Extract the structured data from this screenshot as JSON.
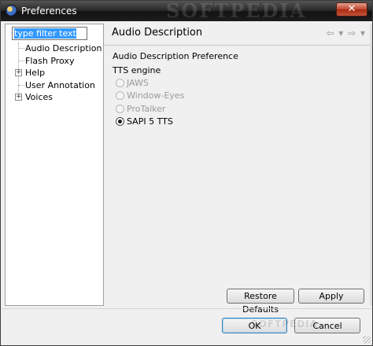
{
  "window": {
    "title": "Preferences",
    "watermark": "SOFTPEDIA",
    "close_glyph": "✕"
  },
  "filter": {
    "value": "type filter text"
  },
  "tree": {
    "items": [
      {
        "label": "Audio Description",
        "expandable": false
      },
      {
        "label": "Flash Proxy",
        "expandable": false
      },
      {
        "label": "Help",
        "expandable": true
      },
      {
        "label": "User Annotation",
        "expandable": false
      },
      {
        "label": "Voices",
        "expandable": true
      }
    ],
    "expander_glyph": "+"
  },
  "page": {
    "title": "Audio Description",
    "nav_back_glyph": "⇦",
    "nav_menu_glyph": "▾",
    "nav_forward_glyph": "⇨",
    "section_label": "Audio Description Preference",
    "tts_label": "TTS engine",
    "options": [
      {
        "label": "JAWS",
        "checked": false,
        "enabled": false
      },
      {
        "label": "Window-Eyes",
        "checked": false,
        "enabled": false
      },
      {
        "label": "ProTalker",
        "checked": false,
        "enabled": false
      },
      {
        "label": "SAPI 5 TTS",
        "checked": true,
        "enabled": true
      }
    ],
    "restore_label": "Restore Defaults",
    "apply_label": "Apply"
  },
  "footer": {
    "ok_label": "OK",
    "cancel_label": "Cancel",
    "watermark": "SOFTPEDIA"
  },
  "colors": {
    "selection": "#3399ff",
    "close_button": "#c2432b",
    "default_button_border": "#3c7fb1"
  }
}
